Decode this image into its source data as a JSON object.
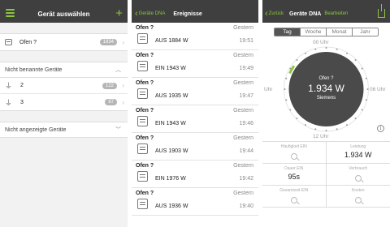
{
  "screen1": {
    "title": "Gerät auswählen",
    "devices": [
      {
        "label": "Ofen ?",
        "count": "1934"
      }
    ],
    "section_unnamed": {
      "label": "Nicht benannte Geräte",
      "items": [
        {
          "label": "2",
          "count": "122"
        },
        {
          "label": "3",
          "count": "87"
        }
      ]
    },
    "section_hidden": {
      "label": "Nicht angezeigte Geräte"
    }
  },
  "screen2": {
    "back_label": "Geräte DNA",
    "title": "Ereignisse",
    "events": [
      {
        "title": "Ofen ?",
        "value": "AUS 1884 W",
        "date": "Gestern",
        "time": "19:51"
      },
      {
        "title": "Ofen ?",
        "value": "EIN 1943 W",
        "date": "Gestern",
        "time": "19:49"
      },
      {
        "title": "Ofen ?",
        "value": "AUS 1935 W",
        "date": "Gestern",
        "time": "19:47"
      },
      {
        "title": "Ofen ?",
        "value": "EIN 1943 W",
        "date": "Gestern",
        "time": "19:46"
      },
      {
        "title": "Ofen ?",
        "value": "AUS 1903 W",
        "date": "Gestern",
        "time": "19:44"
      },
      {
        "title": "Ofen ?",
        "value": "EIN 1976 W",
        "date": "Gestern",
        "time": "19:42"
      },
      {
        "title": "Ofen ?",
        "value": "AUS 1936 W",
        "date": "Gestern",
        "time": "19:40"
      }
    ]
  },
  "screen3": {
    "back_label": "Zurück",
    "title": "Geräte DNA",
    "edit_label": "Bearbeiten",
    "tabs": [
      "Tag",
      "Woche",
      "Monat",
      "Jahr"
    ],
    "active_tab": "Tag",
    "gauge": {
      "top": "00 Uhr",
      "left": "Uhr",
      "right": "06 Uhr",
      "bottom": "12 Uhr",
      "device": "Ofen ?",
      "power": "1.934 W",
      "brand": "Siemens",
      "colors": {
        "dial": "#4a4a4a",
        "accent": "#8cc63f"
      }
    },
    "info_label": "i",
    "tiles": [
      {
        "label": "Häufigkeit EIN",
        "value": ""
      },
      {
        "label": "Leistung",
        "value": "1.934 W"
      },
      {
        "label": "Dauer EIN",
        "value": "95s"
      },
      {
        "label": "Verbrauch",
        "value": ""
      },
      {
        "label": "Gesamtzeit EIN",
        "value": ""
      },
      {
        "label": "Kosten",
        "value": ""
      }
    ]
  }
}
